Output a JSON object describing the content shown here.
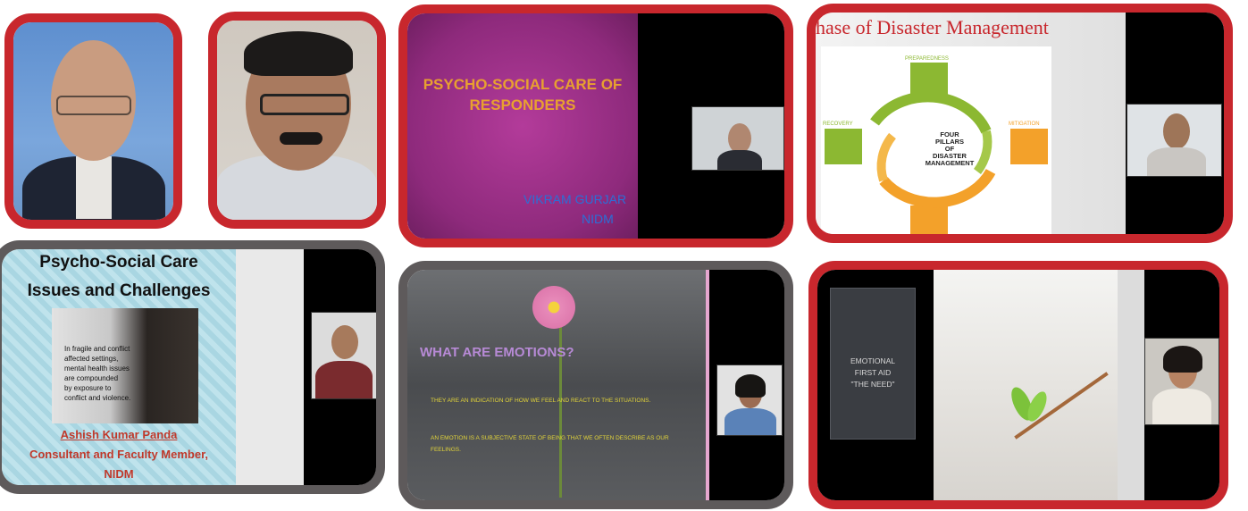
{
  "tiles": {
    "t3": {
      "title_line1": "PSYCHO-SOCIAL CARE OF",
      "title_line2": "RESPONDERS",
      "author": "VIKRAM GURJAR",
      "org": "NIDM"
    },
    "t4": {
      "title": "hase of Disaster Management",
      "center_lines": [
        "FOUR",
        "PILLARS",
        "OF",
        "DISASTER",
        "MANAGEMENT"
      ],
      "labels": {
        "top": "PREPAREDNESS",
        "left": "RECOVERY",
        "right": "MITIGATION"
      }
    },
    "t5": {
      "title_line1": "Psycho-Social Care",
      "title_line2": "Issues and Challenges",
      "quote": [
        "In fragile and conflict",
        "affected settings,",
        "mental health issues",
        "are compounded",
        "by exposure to",
        "conflict and violence."
      ],
      "name": "Ashish Kumar Panda",
      "role": "Consultant and Faculty Member,",
      "org": "NIDM"
    },
    "t6": {
      "heading": "WHAT ARE EMOTIONS?",
      "bullet1": "THEY ARE AN INDICATION OF HOW WE FEEL AND REACT TO THE SITUATIONS.",
      "bullet2_line1": "AN EMOTION IS A SUBJECTIVE STATE OF BEING THAT WE OFTEN DESCRIBE AS OUR",
      "bullet2_line2": "FEELINGS."
    },
    "t7": {
      "line1": "EMOTIONAL",
      "line2": "FIRST AID",
      "line3": "\"THE NEED\""
    }
  },
  "colors": {
    "red_frame": "#c8272d",
    "gray_frame": "#5e5a5b",
    "slide_magenta": "#a0338a",
    "pillar_green": "#8cb832",
    "pillar_orange": "#f3a12a"
  }
}
